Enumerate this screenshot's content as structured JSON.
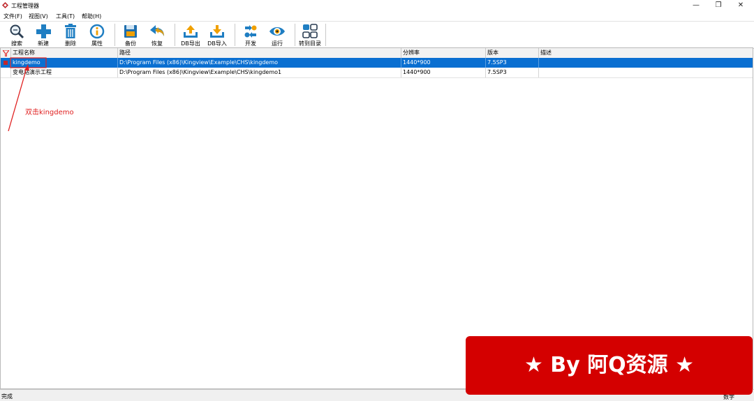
{
  "window": {
    "title": "工程管理器",
    "controls": {
      "minimize": "—",
      "restore": "❐",
      "close": "✕"
    }
  },
  "menu": [
    "文件(F)",
    "视图(V)",
    "工具(T)",
    "帮助(H)"
  ],
  "toolbar": [
    {
      "label": "搜索",
      "icon": "search-icon"
    },
    {
      "label": "新建",
      "icon": "plus-icon"
    },
    {
      "label": "删除",
      "icon": "trash-icon"
    },
    {
      "label": "属性",
      "icon": "info-icon"
    },
    {
      "label": "备份",
      "icon": "floppy-icon"
    },
    {
      "label": "恢复",
      "icon": "undo-icon"
    },
    {
      "label": "DB导出",
      "icon": "db-export-icon"
    },
    {
      "label": "DB导入",
      "icon": "db-import-icon"
    },
    {
      "label": "开发",
      "icon": "develop-icon"
    },
    {
      "label": "运行",
      "icon": "eye-icon"
    },
    {
      "label": "转到目录",
      "icon": "grid-icon"
    }
  ],
  "table": {
    "columns": [
      "工程名称",
      "路径",
      "分辨率",
      "版本",
      "描述"
    ],
    "rows": [
      {
        "name": "kingdemo",
        "path": "D:\\Program Files (x86)\\Kingview\\Example\\CHS\\kingdemo",
        "resolution": "1440*900",
        "version": "7.5SP3",
        "description": ""
      },
      {
        "name": "变电站演示工程",
        "path": "D:\\Program Files (x86)\\Kingview\\Example\\CHS\\kingdemo1",
        "resolution": "1440*900",
        "version": "7.5SP3",
        "description": ""
      }
    ]
  },
  "annotation": {
    "text": "双击kingdemo",
    "color": "#e02020"
  },
  "status": {
    "left": "完成",
    "right": "数字"
  },
  "watermark": {
    "text": "★ By 阿Q资源 ★",
    "color": "#d40000"
  },
  "colors": {
    "selection": "#0a6fd1"
  }
}
